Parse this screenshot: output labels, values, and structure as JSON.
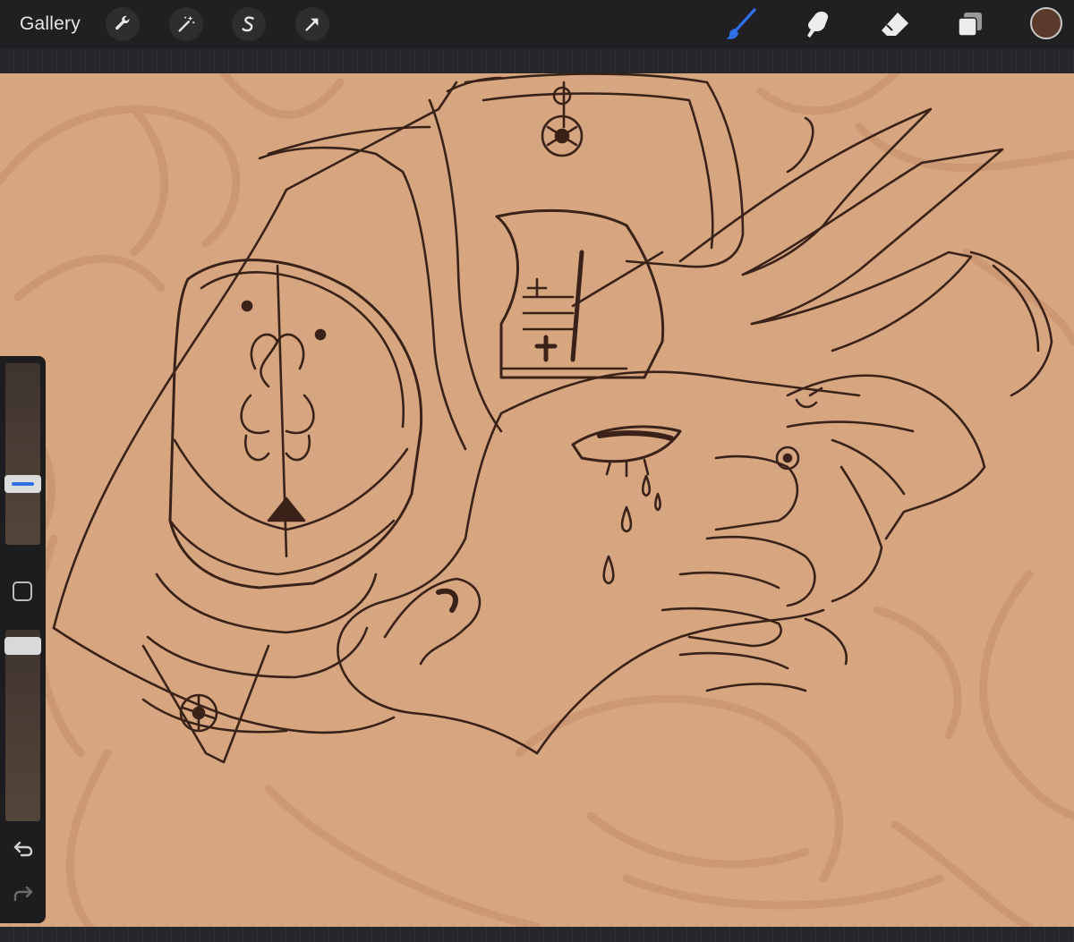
{
  "toolbar": {
    "gallery_label": "Gallery",
    "left_tools": [
      {
        "name": "actions",
        "icon": "wrench-icon"
      },
      {
        "name": "adjustments",
        "icon": "magic-wand-icon"
      },
      {
        "name": "selection",
        "icon": "selection-s-icon"
      },
      {
        "name": "transform",
        "icon": "arrow-cursor-icon"
      }
    ],
    "right_tools": [
      {
        "name": "paint",
        "icon": "brush-icon",
        "active": true
      },
      {
        "name": "smudge",
        "icon": "smudge-finger-icon",
        "active": false
      },
      {
        "name": "erase",
        "icon": "eraser-icon",
        "active": false
      },
      {
        "name": "layers",
        "icon": "layers-icon",
        "active": false
      }
    ],
    "current_color": "#5a3a2a"
  },
  "colors": {
    "canvas": "#d6a680",
    "line_art": "#3a2219",
    "sketch": "#c79268",
    "accent": "#2f6fe8"
  },
  "sidebar": {
    "brush_size_slider": {
      "icon": "size-slider"
    },
    "modify_button": {
      "icon": "square-icon"
    },
    "opacity_slider": {
      "icon": "opacity-slider"
    },
    "undo": {
      "icon": "undo-arrow-icon"
    },
    "redo": {
      "icon": "redo-arrow-icon"
    }
  }
}
